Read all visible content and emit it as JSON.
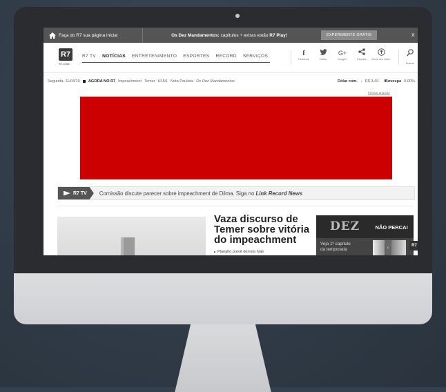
{
  "promo": {
    "home_text": "Faça do R7 sua página inicial",
    "msg_bold": "Os Dez Mandamentos:",
    "msg_rest": " capítulos + extras estão ",
    "msg_end": "R7 Play!",
    "try_button": "EXPERIMENTE GRÁTIS",
    "close": "X"
  },
  "header": {
    "logo": "R7",
    "logo_sub": "R7.COM",
    "nav": [
      "R7 TV",
      "NOTÍCIAS",
      "ENTRETENIMENTO",
      "ESPORTES",
      "RECORD",
      "SERVIÇOS"
    ],
    "social": [
      {
        "icon": "facebook-icon",
        "glyph": "f",
        "label": "Facebook"
      },
      {
        "icon": "twitter-icon",
        "glyph": "🐦",
        "label": "Twitter"
      },
      {
        "icon": "google-plus-icon",
        "glyph": "G+",
        "label": "Google+"
      },
      {
        "icon": "share-icon",
        "glyph": "<",
        "label": "Espalhe"
      },
      {
        "icon": "upload-icon",
        "glyph": "⊙",
        "label": "Envie seu vídeo"
      }
    ],
    "search_label": "Buscar"
  },
  "datebar": {
    "date": "Segunda, 11/04/16",
    "agora": "AGORA NO R7",
    "links": [
      "Impeachment",
      "Temer",
      "H1N1",
      "Nota Paulista"
    ],
    "italic_link": "Os Dez Mandamentos",
    "dolar_label": "Dólar com.",
    "dolar_value": "R$ 3,49",
    "ibov_label": "IBovespa",
    "ibov_value": "0,00%"
  },
  "ad": {
    "close_label": "Fechar anúncio",
    "color": "#cc0000"
  },
  "ticker": {
    "badge": "R7 TV",
    "text": "Comissão discute parecer sobre impeachment de Dilma. Siga no ",
    "link": "Link Record News"
  },
  "news": {
    "headline": "Vaza discurso de Temer sobre vitória do impeachment",
    "bullet": "Planalto prevê derrota hoje"
  },
  "promo_box": {
    "title": "DEZ",
    "cta": "NÃO PERCA!",
    "veja": "Veja 1º capítulo da temporada",
    "badge": "R7"
  }
}
